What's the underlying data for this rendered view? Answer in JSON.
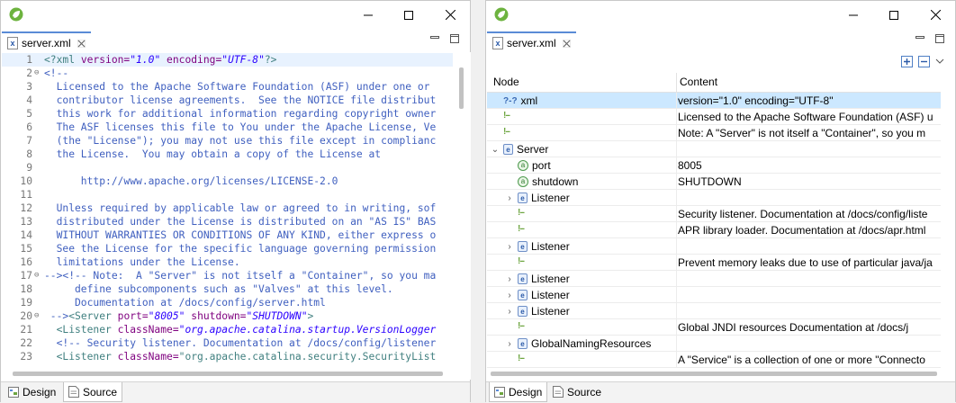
{
  "left_window": {
    "tab": {
      "label": "server.xml"
    },
    "bottom_tabs": [
      {
        "label": "Design"
      },
      {
        "label": "Source"
      }
    ],
    "lines": [
      {
        "n": "1",
        "fold": "",
        "tokens": [
          [
            "c-pi",
            "<?xml "
          ],
          [
            "c-attr",
            "version="
          ],
          [
            "c-val",
            "\"1.0\""
          ],
          [
            "c-attr",
            " encoding="
          ],
          [
            "c-val",
            "\"UTF-8\""
          ],
          [
            "c-pi",
            "?>"
          ]
        ]
      },
      {
        "n": "2",
        "fold": "⊖",
        "tokens": [
          [
            "c-com",
            "<!--"
          ]
        ]
      },
      {
        "n": "3",
        "fold": "",
        "tokens": [
          [
            "c-com",
            "  Licensed to the Apache Software Foundation (ASF) under one or"
          ]
        ]
      },
      {
        "n": "4",
        "fold": "",
        "tokens": [
          [
            "c-com",
            "  contributor license agreements.  See the NOTICE file distribut"
          ]
        ]
      },
      {
        "n": "5",
        "fold": "",
        "tokens": [
          [
            "c-com",
            "  this work for additional information regarding copyright owner"
          ]
        ]
      },
      {
        "n": "6",
        "fold": "",
        "tokens": [
          [
            "c-com",
            "  The ASF licenses this file to You under the Apache License, Ve"
          ]
        ]
      },
      {
        "n": "7",
        "fold": "",
        "tokens": [
          [
            "c-com",
            "  (the \"License\"); you may not use this file except in complianc"
          ]
        ]
      },
      {
        "n": "8",
        "fold": "",
        "tokens": [
          [
            "c-com",
            "  the License.  You may obtain a copy of the License at"
          ]
        ]
      },
      {
        "n": "9",
        "fold": "",
        "tokens": [
          [
            "c-com",
            ""
          ]
        ]
      },
      {
        "n": "10",
        "fold": "",
        "tokens": [
          [
            "c-com",
            "      http://www.apache.org/licenses/LICENSE-2.0"
          ]
        ]
      },
      {
        "n": "11",
        "fold": "",
        "tokens": [
          [
            "c-com",
            ""
          ]
        ]
      },
      {
        "n": "12",
        "fold": "",
        "tokens": [
          [
            "c-com",
            "  Unless required by applicable law or agreed to in writing, sof"
          ]
        ]
      },
      {
        "n": "13",
        "fold": "",
        "tokens": [
          [
            "c-com",
            "  distributed under the License is distributed on an \"AS IS\" BAS"
          ]
        ]
      },
      {
        "n": "14",
        "fold": "",
        "tokens": [
          [
            "c-com",
            "  WITHOUT WARRANTIES OR CONDITIONS OF ANY KIND, either express o"
          ]
        ]
      },
      {
        "n": "15",
        "fold": "",
        "tokens": [
          [
            "c-com",
            "  See the License for the specific language governing permission"
          ]
        ]
      },
      {
        "n": "16",
        "fold": "",
        "tokens": [
          [
            "c-com",
            "  limitations under the License."
          ]
        ]
      },
      {
        "n": "17",
        "fold": "⊖",
        "tokens": [
          [
            "c-com",
            "--><!-- Note:  A \"Server\" is not itself a \"Container\", so you ma"
          ]
        ]
      },
      {
        "n": "18",
        "fold": "",
        "tokens": [
          [
            "c-com",
            "     define subcomponents such as \"Valves\" at this level."
          ]
        ]
      },
      {
        "n": "19",
        "fold": "",
        "tokens": [
          [
            "c-com",
            "     Documentation at /docs/config/server.html"
          ]
        ]
      },
      {
        "n": "20",
        "fold": "⊖",
        "tokens": [
          [
            "c-com",
            " -->"
          ],
          [
            "c-tag",
            "<Server "
          ],
          [
            "c-attr",
            "port="
          ],
          [
            "c-val",
            "\"8005\""
          ],
          [
            "c-attr",
            " shutdown="
          ],
          [
            "c-val",
            "\"SHUTDOWN\""
          ],
          [
            "c-tag",
            ">"
          ]
        ]
      },
      {
        "n": "21",
        "fold": "",
        "tokens": [
          [
            "c-tag",
            "  <Listener "
          ],
          [
            "c-attr",
            "className="
          ],
          [
            "c-val",
            "\"org.apache.catalina.startup.VersionLogger"
          ]
        ]
      },
      {
        "n": "22",
        "fold": "",
        "tokens": [
          [
            "c-com",
            "  <!-- Security listener. Documentation at /docs/config/listener"
          ]
        ]
      },
      {
        "n": "23",
        "fold": "",
        "tokens": [
          [
            "c-tag",
            "  <Listener "
          ],
          [
            "c-attr",
            "className="
          ],
          [
            "c-tag",
            "\"org.apache.catalina.security.SecurityList"
          ]
        ]
      }
    ]
  },
  "right_window": {
    "tab": {
      "label": "server.xml"
    },
    "bottom_tabs": [
      {
        "label": "Design"
      },
      {
        "label": "Source"
      }
    ],
    "columns": {
      "node": "Node",
      "content": "Content"
    },
    "rows": [
      {
        "depth": 0,
        "twisty": "",
        "icon": "pi",
        "node": "xml",
        "content": "version=\"1.0\" encoding=\"UTF-8\"",
        "selected": true
      },
      {
        "depth": 0,
        "twisty": "",
        "icon": "comment",
        "node": "",
        "content": " Licensed to the Apache Software Foundation (ASF) u"
      },
      {
        "depth": 0,
        "twisty": "",
        "icon": "comment",
        "node": "",
        "content": " Note:  A \"Server\" is not itself a \"Container\", so you m"
      },
      {
        "depth": 0,
        "twisty": "⌄",
        "icon": "element",
        "node": "Server",
        "content": ""
      },
      {
        "depth": 1,
        "twisty": "",
        "icon": "attribute",
        "node": "port",
        "content": "8005"
      },
      {
        "depth": 1,
        "twisty": "",
        "icon": "attribute",
        "node": "shutdown",
        "content": "SHUTDOWN"
      },
      {
        "depth": 1,
        "twisty": "›",
        "icon": "element",
        "node": "Listener",
        "content": ""
      },
      {
        "depth": 1,
        "twisty": "",
        "icon": "comment",
        "node": "",
        "content": " Security listener. Documentation at /docs/config/liste"
      },
      {
        "depth": 1,
        "twisty": "",
        "icon": "comment",
        "node": "",
        "content": " APR library loader. Documentation at /docs/apr.html"
      },
      {
        "depth": 1,
        "twisty": "›",
        "icon": "element",
        "node": "Listener",
        "content": ""
      },
      {
        "depth": 1,
        "twisty": "",
        "icon": "comment",
        "node": "",
        "content": " Prevent memory leaks due to use of particular java/ja"
      },
      {
        "depth": 1,
        "twisty": "›",
        "icon": "element",
        "node": "Listener",
        "content": ""
      },
      {
        "depth": 1,
        "twisty": "›",
        "icon": "element",
        "node": "Listener",
        "content": ""
      },
      {
        "depth": 1,
        "twisty": "›",
        "icon": "element",
        "node": "Listener",
        "content": ""
      },
      {
        "depth": 1,
        "twisty": "",
        "icon": "comment",
        "node": "",
        "content": " Global JNDI resources        Documentation at /docs/j"
      },
      {
        "depth": 1,
        "twisty": "›",
        "icon": "element",
        "node": "GlobalNamingResources",
        "content": ""
      },
      {
        "depth": 1,
        "twisty": "",
        "icon": "comment",
        "node": "",
        "content": " A \"Service\" is a collection of one or more \"Connecto"
      }
    ]
  },
  "icons": {
    "pi": "?-?",
    "comment": "!--",
    "element": "e",
    "attribute": "a"
  },
  "colors": {
    "accent": "#5a8bd6",
    "selection": "#cce8ff",
    "comment": "#3f5fbf",
    "tag": "#3f7f7f",
    "attr": "#7f007f",
    "value": "#2a00ff"
  }
}
